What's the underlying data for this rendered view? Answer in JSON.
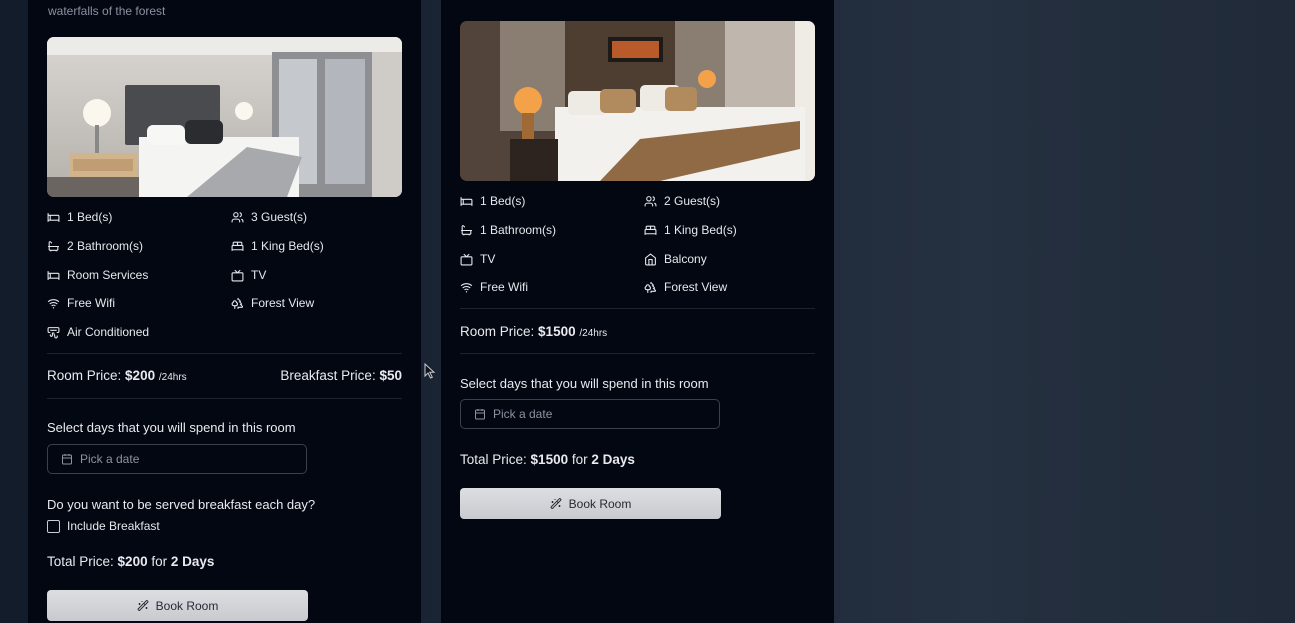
{
  "card1": {
    "subtitle": "waterfalls of the forest",
    "amenities": [
      {
        "icon": "bed-icon",
        "label": "1 Bed(s)"
      },
      {
        "icon": "users-icon",
        "label": "3 Guest(s)"
      },
      {
        "icon": "bath-icon",
        "label": "2 Bathroom(s)"
      },
      {
        "icon": "king-bed-icon",
        "label": "1 King Bed(s)"
      },
      {
        "icon": "room-service-icon",
        "label": "Room Services"
      },
      {
        "icon": "tv-icon",
        "label": "TV"
      },
      {
        "icon": "wifi-icon",
        "label": "Free Wifi"
      },
      {
        "icon": "trees-icon",
        "label": "Forest View"
      },
      {
        "icon": "air-vent-icon",
        "label": "Air Conditioned"
      }
    ],
    "room_price_label": "Room Price:",
    "room_price": "$200",
    "room_price_unit": "/24hrs",
    "breakfast_price_label": "Breakfast Price:",
    "breakfast_price": "$50",
    "select_days_label": "Select days that you will spend in this room",
    "date_placeholder": "Pick a date",
    "breakfast_question": "Do you want to be served breakfast each day?",
    "include_breakfast_label": "Include Breakfast",
    "total_label": "Total Price:",
    "total_price": "$200",
    "for_text": "for",
    "total_days": "2 Days",
    "book_button": "Book Room"
  },
  "card2": {
    "amenities": [
      {
        "icon": "bed-icon",
        "label": "1 Bed(s)"
      },
      {
        "icon": "users-icon",
        "label": "2 Guest(s)"
      },
      {
        "icon": "bath-icon",
        "label": "1 Bathroom(s)"
      },
      {
        "icon": "king-bed-icon",
        "label": "1 King Bed(s)"
      },
      {
        "icon": "tv-icon",
        "label": "TV"
      },
      {
        "icon": "home-icon",
        "label": "Balcony"
      },
      {
        "icon": "wifi-icon",
        "label": "Free Wifi"
      },
      {
        "icon": "trees-icon",
        "label": "Forest View"
      }
    ],
    "room_price_label": "Room Price:",
    "room_price": "$1500",
    "room_price_unit": "/24hrs",
    "select_days_label": "Select days that you will spend in this room",
    "date_placeholder": "Pick a date",
    "total_label": "Total Price:",
    "total_price": "$1500",
    "for_text": "for",
    "total_days": "2 Days",
    "book_button": "Book Room"
  }
}
